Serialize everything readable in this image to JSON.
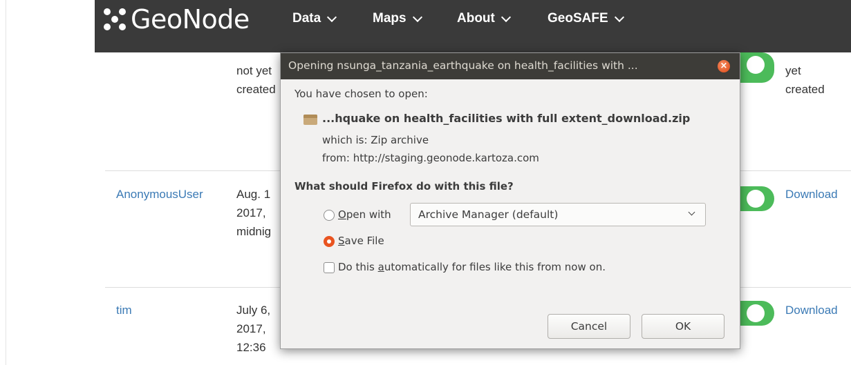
{
  "navbar": {
    "logo_text": "GeoNode",
    "items": [
      {
        "label": "Data"
      },
      {
        "label": "Maps"
      },
      {
        "label": "About"
      },
      {
        "label": "GeoSAFE"
      }
    ]
  },
  "table": {
    "row1": {
      "date_lines": [
        "not yet",
        "created"
      ],
      "download_lines": [
        "yet",
        "created"
      ]
    },
    "row2": {
      "user": "AnonymousUser",
      "date_lines": [
        "Aug. 1",
        "2017,",
        "midnig"
      ],
      "download": "Download"
    },
    "row3": {
      "user": "tim",
      "date_lines": [
        "July 6,",
        "2017,",
        "12:36"
      ],
      "download": "Download"
    }
  },
  "dialog": {
    "title": "Opening nsunga_tanzania_earthquake on health_facilities with ...",
    "intro": "You have chosen to open:",
    "filename": "...hquake on health_facilities with full extent_download.zip",
    "which_is": "which is:  Zip archive",
    "from": "from:  http://staging.geonode.kartoza.com",
    "question": "What should Firefox do with this file?",
    "open_with": {
      "mnemonic": "O",
      "rest": "pen with",
      "selected": false
    },
    "app_select": {
      "value": "Archive Manager (default)"
    },
    "save_file": {
      "mnemonic": "S",
      "rest": "ave File",
      "selected": true
    },
    "auto": {
      "before": "Do this ",
      "mnemonic": "a",
      "after": "utomatically for files like this from now on.",
      "checked": false
    },
    "buttons": {
      "cancel": "Cancel",
      "ok": "OK"
    },
    "colors": {
      "titlebar": "#3d3c38",
      "accent": "#e95420",
      "body": "#f2f1f0"
    }
  }
}
